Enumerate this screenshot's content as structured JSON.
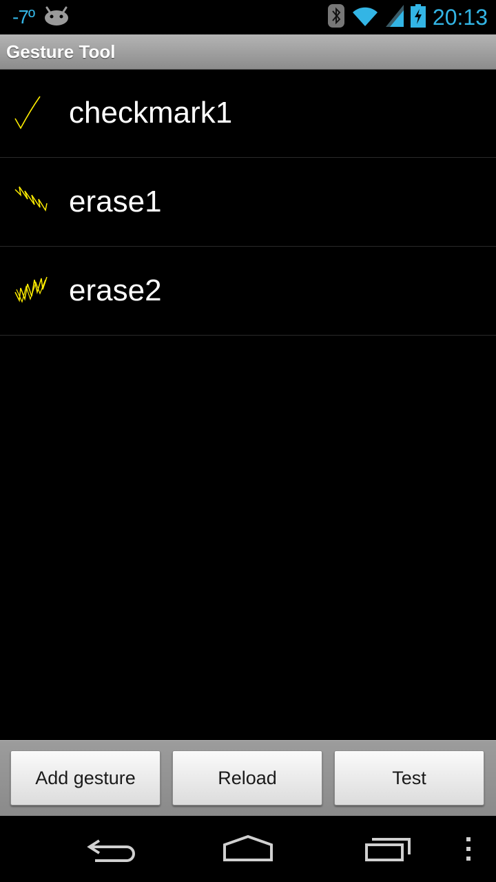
{
  "status_bar": {
    "temperature": "-7º",
    "time": "20:13",
    "icons": [
      "android-icon",
      "bluetooth-icon",
      "wifi-icon",
      "signal-icon",
      "battery-charging-icon"
    ],
    "accent_color": "#33b5e5"
  },
  "app": {
    "title": "Gesture Tool"
  },
  "gestures": [
    {
      "name": "checkmark1",
      "thumbnail": "checkmark-gesture-icon"
    },
    {
      "name": "erase1",
      "thumbnail": "erase-gesture-icon"
    },
    {
      "name": "erase2",
      "thumbnail": "erase-gesture-icon"
    }
  ],
  "gesture_stroke_color": "#ffee00",
  "buttons": {
    "add_label": "Add gesture",
    "reload_label": "Reload",
    "test_label": "Test"
  },
  "nav_bar": {
    "icons": [
      "back-icon",
      "home-icon",
      "recent-apps-icon",
      "overflow-menu-icon"
    ]
  }
}
